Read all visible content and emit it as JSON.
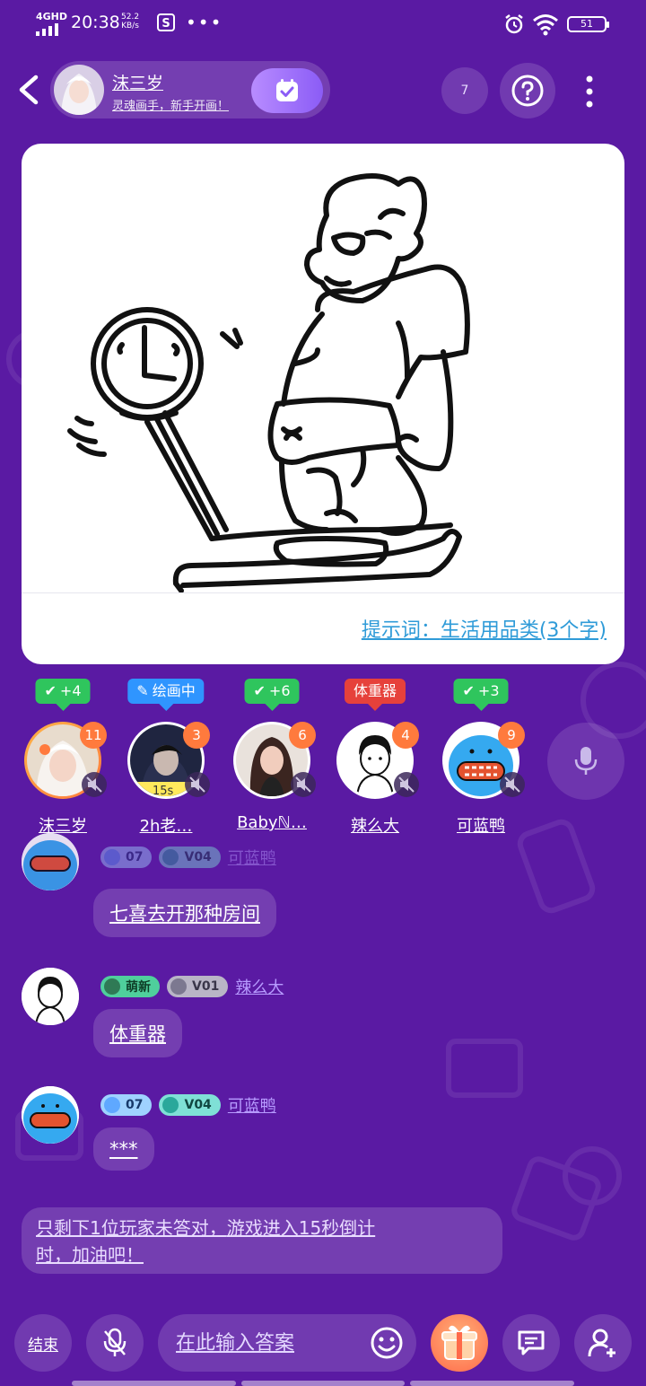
{
  "status_bar": {
    "network": "4GHD",
    "time": "20:38",
    "speed_value": "52.2",
    "speed_unit": "KB/s",
    "dots": "•••",
    "battery": "51"
  },
  "header": {
    "host_name": "沫三岁",
    "host_subtitle": "灵魂画手，新手开画！",
    "viewer_count": "7",
    "help_icon": "question-circle-icon",
    "more_icon": "vertical-dots-icon",
    "check_icon": "calendar-check-icon"
  },
  "canvas": {
    "hint_label": "提示词：",
    "hint_value": "生活用品类(3个字)",
    "drawing_icon": "person-on-scale-sketch"
  },
  "players": [
    {
      "tag": "+4",
      "tag_style": "green",
      "tag_icon": "check",
      "score": "11",
      "name": "沫三岁"
    },
    {
      "tag": "绘画中",
      "tag_style": "blue",
      "tag_icon": "pencil",
      "score": "3",
      "name": "2h老…",
      "timer": "15s"
    },
    {
      "tag": "+6",
      "tag_style": "green",
      "tag_icon": "check",
      "score": "6",
      "name": "Babyℕ…"
    },
    {
      "tag": "体重器",
      "tag_style": "red",
      "tag_icon": "",
      "score": "4",
      "name": "辣么大"
    },
    {
      "tag": "+3",
      "tag_style": "green",
      "tag_icon": "check",
      "score": "9",
      "name": "可蓝鸭"
    }
  ],
  "chat": [
    {
      "level_badge": "07",
      "vip_badge": "V04",
      "user": "可蓝鸭",
      "text": "七喜去开那种房间"
    },
    {
      "level_badge": "萌新",
      "vip_badge": "V01",
      "user": "辣么大",
      "text": "体重器"
    },
    {
      "level_badge": "07",
      "vip_badge": "V04",
      "user": "可蓝鸭",
      "text": "***"
    }
  ],
  "system_message": {
    "line1_a": "只剩下1位玩家未答对，",
    "line1_b": "游戏进入15秒倒计",
    "line2": "时，加油吧！"
  },
  "bottom_bar": {
    "end_label": "结束",
    "input_placeholder": "在此输入答案",
    "mic_icon": "mic-off-icon",
    "emoji_icon": "smile-icon",
    "gift_icon": "gift-icon",
    "chat_icon": "chat-bubble-icon",
    "add_friend_icon": "add-user-icon"
  },
  "colors": {
    "background": "#5a1aa3",
    "accent": "#8b5cf6",
    "score_badge": "#ff7a3d",
    "tag_green": "#2fc55d",
    "tag_blue": "#2f95ff",
    "tag_red": "#e6413b",
    "hint_text": "#2f9bd8"
  }
}
